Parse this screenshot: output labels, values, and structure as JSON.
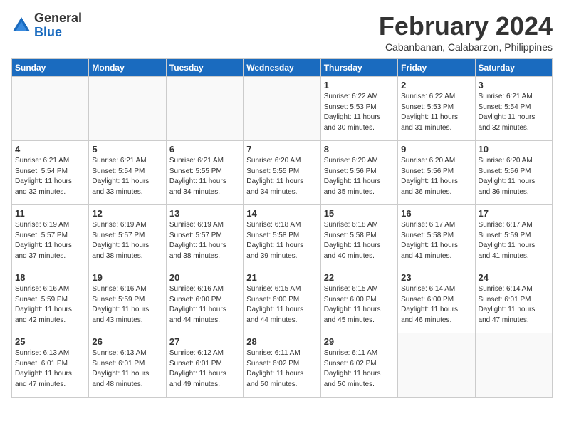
{
  "logo": {
    "general": "General",
    "blue": "Blue"
  },
  "title": "February 2024",
  "location": "Cabanbanan, Calabarzon, Philippines",
  "days_header": [
    "Sunday",
    "Monday",
    "Tuesday",
    "Wednesday",
    "Thursday",
    "Friday",
    "Saturday"
  ],
  "weeks": [
    [
      {
        "day": "",
        "info": ""
      },
      {
        "day": "",
        "info": ""
      },
      {
        "day": "",
        "info": ""
      },
      {
        "day": "",
        "info": ""
      },
      {
        "day": "1",
        "info": "Sunrise: 6:22 AM\nSunset: 5:53 PM\nDaylight: 11 hours\nand 30 minutes."
      },
      {
        "day": "2",
        "info": "Sunrise: 6:22 AM\nSunset: 5:53 PM\nDaylight: 11 hours\nand 31 minutes."
      },
      {
        "day": "3",
        "info": "Sunrise: 6:21 AM\nSunset: 5:54 PM\nDaylight: 11 hours\nand 32 minutes."
      }
    ],
    [
      {
        "day": "4",
        "info": "Sunrise: 6:21 AM\nSunset: 5:54 PM\nDaylight: 11 hours\nand 32 minutes."
      },
      {
        "day": "5",
        "info": "Sunrise: 6:21 AM\nSunset: 5:54 PM\nDaylight: 11 hours\nand 33 minutes."
      },
      {
        "day": "6",
        "info": "Sunrise: 6:21 AM\nSunset: 5:55 PM\nDaylight: 11 hours\nand 34 minutes."
      },
      {
        "day": "7",
        "info": "Sunrise: 6:20 AM\nSunset: 5:55 PM\nDaylight: 11 hours\nand 34 minutes."
      },
      {
        "day": "8",
        "info": "Sunrise: 6:20 AM\nSunset: 5:56 PM\nDaylight: 11 hours\nand 35 minutes."
      },
      {
        "day": "9",
        "info": "Sunrise: 6:20 AM\nSunset: 5:56 PM\nDaylight: 11 hours\nand 36 minutes."
      },
      {
        "day": "10",
        "info": "Sunrise: 6:20 AM\nSunset: 5:56 PM\nDaylight: 11 hours\nand 36 minutes."
      }
    ],
    [
      {
        "day": "11",
        "info": "Sunrise: 6:19 AM\nSunset: 5:57 PM\nDaylight: 11 hours\nand 37 minutes."
      },
      {
        "day": "12",
        "info": "Sunrise: 6:19 AM\nSunset: 5:57 PM\nDaylight: 11 hours\nand 38 minutes."
      },
      {
        "day": "13",
        "info": "Sunrise: 6:19 AM\nSunset: 5:57 PM\nDaylight: 11 hours\nand 38 minutes."
      },
      {
        "day": "14",
        "info": "Sunrise: 6:18 AM\nSunset: 5:58 PM\nDaylight: 11 hours\nand 39 minutes."
      },
      {
        "day": "15",
        "info": "Sunrise: 6:18 AM\nSunset: 5:58 PM\nDaylight: 11 hours\nand 40 minutes."
      },
      {
        "day": "16",
        "info": "Sunrise: 6:17 AM\nSunset: 5:58 PM\nDaylight: 11 hours\nand 41 minutes."
      },
      {
        "day": "17",
        "info": "Sunrise: 6:17 AM\nSunset: 5:59 PM\nDaylight: 11 hours\nand 41 minutes."
      }
    ],
    [
      {
        "day": "18",
        "info": "Sunrise: 6:16 AM\nSunset: 5:59 PM\nDaylight: 11 hours\nand 42 minutes."
      },
      {
        "day": "19",
        "info": "Sunrise: 6:16 AM\nSunset: 5:59 PM\nDaylight: 11 hours\nand 43 minutes."
      },
      {
        "day": "20",
        "info": "Sunrise: 6:16 AM\nSunset: 6:00 PM\nDaylight: 11 hours\nand 44 minutes."
      },
      {
        "day": "21",
        "info": "Sunrise: 6:15 AM\nSunset: 6:00 PM\nDaylight: 11 hours\nand 44 minutes."
      },
      {
        "day": "22",
        "info": "Sunrise: 6:15 AM\nSunset: 6:00 PM\nDaylight: 11 hours\nand 45 minutes."
      },
      {
        "day": "23",
        "info": "Sunrise: 6:14 AM\nSunset: 6:00 PM\nDaylight: 11 hours\nand 46 minutes."
      },
      {
        "day": "24",
        "info": "Sunrise: 6:14 AM\nSunset: 6:01 PM\nDaylight: 11 hours\nand 47 minutes."
      }
    ],
    [
      {
        "day": "25",
        "info": "Sunrise: 6:13 AM\nSunset: 6:01 PM\nDaylight: 11 hours\nand 47 minutes."
      },
      {
        "day": "26",
        "info": "Sunrise: 6:13 AM\nSunset: 6:01 PM\nDaylight: 11 hours\nand 48 minutes."
      },
      {
        "day": "27",
        "info": "Sunrise: 6:12 AM\nSunset: 6:01 PM\nDaylight: 11 hours\nand 49 minutes."
      },
      {
        "day": "28",
        "info": "Sunrise: 6:11 AM\nSunset: 6:02 PM\nDaylight: 11 hours\nand 50 minutes."
      },
      {
        "day": "29",
        "info": "Sunrise: 6:11 AM\nSunset: 6:02 PM\nDaylight: 11 hours\nand 50 minutes."
      },
      {
        "day": "",
        "info": ""
      },
      {
        "day": "",
        "info": ""
      }
    ]
  ]
}
